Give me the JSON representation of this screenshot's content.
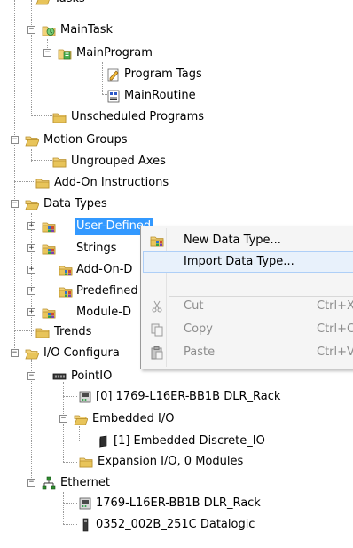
{
  "tree": {
    "tasks": "Tasks",
    "main_task": "MainTask",
    "main_program": "MainProgram",
    "program_tags": "Program Tags",
    "main_routine": "MainRoutine",
    "unscheduled_programs": "Unscheduled Programs",
    "motion_groups": "Motion Groups",
    "ungrouped_axes": "Ungrouped Axes",
    "add_on_instructions": "Add-On Instructions",
    "data_types": "Data Types",
    "user_defined": "User-Defined",
    "strings": "Strings",
    "add_on_defined": "Add-On-D",
    "predefined": "Predefined",
    "module_defined": "Module-D",
    "trends": "Trends",
    "io_configuration": "I/O Configura",
    "point_io": "PointIO",
    "controller_slot": "[0] 1769-L16ER-BB1B DLR_Rack",
    "embedded_io": "Embedded I/O",
    "embedded_discrete": "[1] Embedded Discrete_IO",
    "expansion_io": "Expansion I/O, 0 Modules",
    "ethernet": "Ethernet",
    "eth_controller": "1769-L16ER-BB1B DLR_Rack",
    "datalogic_device": "0352_002B_251C Datalogic"
  },
  "context_menu": {
    "new_data_type": "New Data Type...",
    "import_data_type": "Import Data Type...",
    "cut": "Cut",
    "cut_shortcut": "Ctrl+X",
    "copy": "Copy",
    "copy_shortcut": "Ctrl+C",
    "paste": "Paste",
    "paste_shortcut": "Ctrl+V",
    "highlighted_item": "Import Data Type...",
    "disabled_items": [
      "Cut",
      "Copy",
      "Paste"
    ]
  },
  "colors": {
    "selection": "#3399ff",
    "menu_background": "#f5f5f5",
    "menu_highlight": "#e8f1fb",
    "folder": "#e8c45a"
  }
}
